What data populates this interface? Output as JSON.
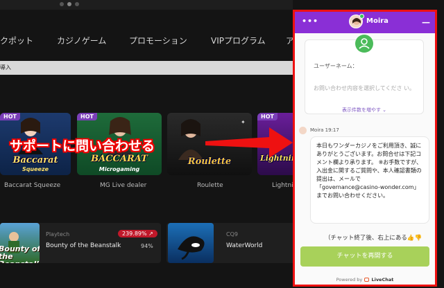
{
  "nav": {
    "items": [
      "クポット",
      "カジノゲーム",
      "プロモーション",
      "VIPプログラム",
      "ア"
    ]
  },
  "notice": {
    "text": "導入"
  },
  "games": [
    {
      "badge": "HOT",
      "title": "Baccarat",
      "subtitle": "Squeeze",
      "name": "Baccarat Squeeze"
    },
    {
      "badge": "HOT",
      "title": "BACCARAT",
      "subtitle": "Microgaming",
      "name": "MG Live dealer"
    },
    {
      "badge": "",
      "title": "Roulette",
      "subtitle": "",
      "name": "Roulette"
    },
    {
      "badge": "HOT",
      "title": "Lightnin",
      "subtitle": "",
      "name": "Lightnin"
    }
  ],
  "rows": [
    {
      "thumb_text": "Bounty of the Beanstalk",
      "provider": "Playtech",
      "name": "Bounty of the Beanstalk",
      "rtp": "239.89% ↗",
      "rtp_small": "94%"
    },
    {
      "thumb_text": "",
      "provider": "CQ9",
      "name": "WaterWorld"
    }
  ],
  "annotation": {
    "text": "サポートに問い合わせる"
  },
  "chat": {
    "menu": "•••",
    "agent_name": "Moira",
    "minimize": "—",
    "form": {
      "label": "ユーザーネーム：",
      "placeholder": "お問い合わせ内容を選択してくださ い。",
      "more": "表示件数を増やす ⌄"
    },
    "message_meta": "Moira 19:17",
    "message": "本日もワンダーカジノをご利用頂き、誠にありがとうございます。お問合せは下記コメント欄より承ります。 ※お手数ですが、入出金に関するご質問や、本人確認書類の提出は、メールで「governance@casino-wonder.com」までお問い合わせください。",
    "footer_text": "（チャット終了後、右上にある👍👎",
    "restart_button": "チャットを再開する",
    "powered_prefix": "Powered by",
    "powered_brand": "LiveChat"
  },
  "colors": {
    "chat_header": "#8a2fd6",
    "restart_button": "#a8d15a",
    "highlight_border": "#ee1111",
    "hot_badge": "#7b3fb8"
  }
}
